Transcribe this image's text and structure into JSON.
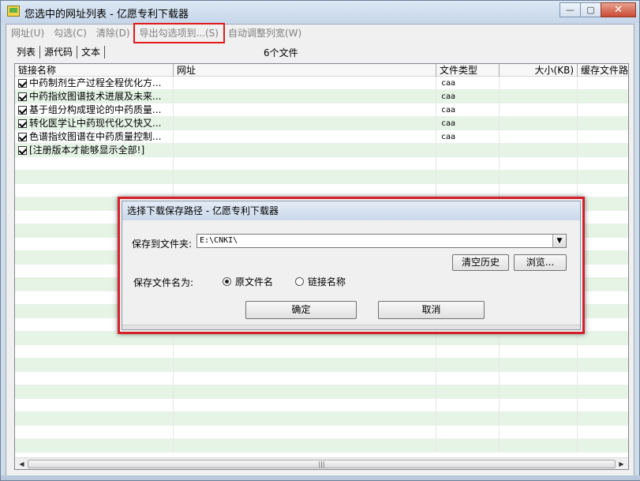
{
  "window": {
    "title": "您选中的网址列表 - 亿愿专利下载器",
    "close_glyph": "✕",
    "minimize_glyph": "—",
    "maximize_glyph": "▢"
  },
  "menu": [
    {
      "label": "网址(U)"
    },
    {
      "label": "勾选(C)"
    },
    {
      "label": "清除(D)"
    },
    {
      "label": "导出勾选项到...(S)"
    },
    {
      "label": "自动调整列宽(W)"
    }
  ],
  "tabs": [
    {
      "label": "列表"
    },
    {
      "label": "源代码"
    },
    {
      "label": "文本"
    }
  ],
  "file_count": "6个文件",
  "columns": {
    "name": "链接名称",
    "url": "网址",
    "type": "文件类型",
    "size": "大小(KB)",
    "cache": "缓存文件路径"
  },
  "rows": [
    {
      "name": "中药制剂生产过程全程优化方...",
      "url": "",
      "type": "caa",
      "checked": true
    },
    {
      "name": "中药指纹图谱技术进展及未来...",
      "url": "",
      "type": "caa",
      "checked": true
    },
    {
      "name": "基于组分构成理论的中药质量...",
      "url": "",
      "type": "caa",
      "checked": true
    },
    {
      "name": "转化医学让中药现代化又快又...",
      "url": "",
      "type": "caa",
      "checked": true
    },
    {
      "name": "色谱指纹图谱在中药质量控制...",
      "url": "",
      "type": "caa",
      "checked": true
    },
    {
      "name": "[注册版本才能够显示全部!]",
      "url": "",
      "type": "",
      "checked": true
    }
  ],
  "scrollbar": {
    "left": "◀",
    "right": "▶",
    "grip": "|||"
  },
  "dialog": {
    "title": "选择下载保存路径 - 亿愿专利下载器",
    "folder_label": "保存到文件夹:",
    "folder_value": "E:\\CNKI\\",
    "combo_arrow": "▼",
    "clear_history": "清空历史",
    "browse": "浏览...",
    "filename_label": "保存文件名为:",
    "option_original": "原文件名",
    "option_link": "链接名称",
    "ok": "确定",
    "cancel": "取消"
  },
  "colors": {
    "highlight_box": "#e21a1a",
    "row_alt": "#e6f4e6",
    "menu_disabled": "#808080"
  }
}
